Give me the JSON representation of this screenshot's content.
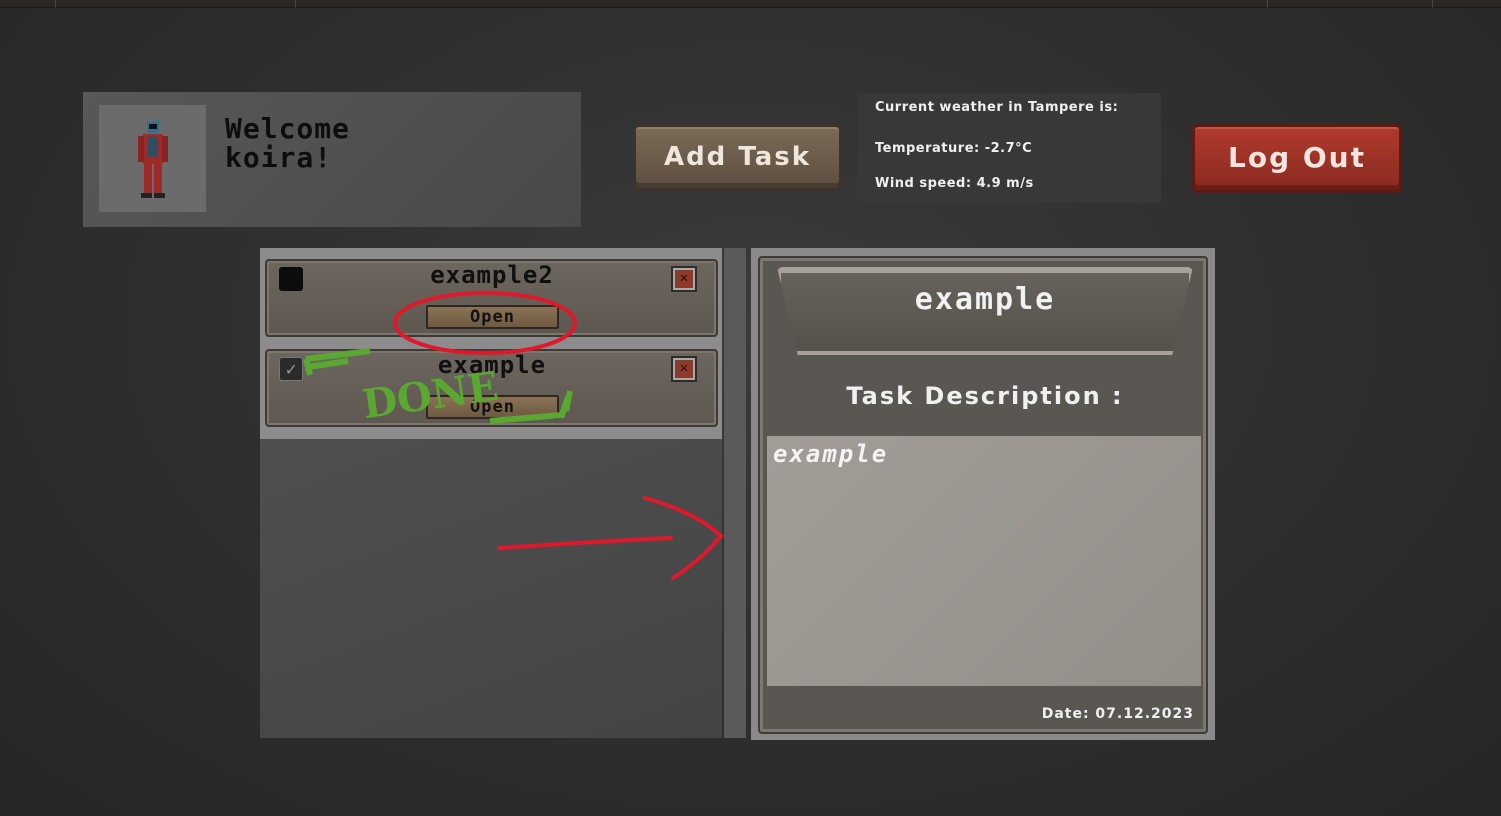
{
  "header": {
    "welcome_line1": "Welcome",
    "welcome_line2": "koira!",
    "add_task_label": "Add Task",
    "logout_label": "Log Out"
  },
  "weather": {
    "title": "Current weather in Tampere is:",
    "temperature": "Temperature: -2.7°C",
    "wind": "Wind speed: 4.9 m/s"
  },
  "tasks": [
    {
      "title": "example2",
      "open_label": "Open",
      "done": false,
      "delete_icon": "x-icon"
    },
    {
      "title": "example",
      "open_label": "Open",
      "done": true,
      "delete_icon": "x-icon"
    }
  ],
  "stamp": {
    "text": "DONE",
    "color": "#5aa832"
  },
  "detail": {
    "title": "example",
    "description_label": "Task Description :",
    "description": "example",
    "date": "Date: 07.12.2023"
  },
  "colors": {
    "logout": "#a03428",
    "add_task": "#6b5c4b",
    "annotation": "#e0182c"
  }
}
